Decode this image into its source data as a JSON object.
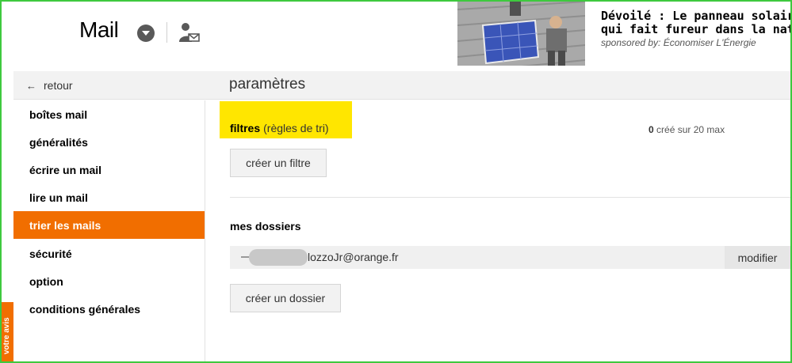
{
  "header": {
    "app_title": "Mail"
  },
  "ad": {
    "headline": "Dévoilé : Le panneau solaire\nqui fait fureur dans la nation",
    "sponsor": "sponsored by: Économiser L'Énergie"
  },
  "topbar": {
    "back_label": "retour",
    "page_title": "paramètres"
  },
  "sidebar": {
    "items": [
      {
        "label": "boîtes mail"
      },
      {
        "label": "généralités"
      },
      {
        "label": "écrire un mail"
      },
      {
        "label": "lire un mail"
      },
      {
        "label": "trier les mails",
        "active": true
      },
      {
        "label": "sécurité"
      },
      {
        "label": "option"
      },
      {
        "label": "conditions générales"
      }
    ],
    "feedback_label": "votre avis"
  },
  "filters": {
    "title": "filtres",
    "subtitle": "(règles de tri)",
    "count": "0",
    "count_suffix": "créé sur 20 max",
    "create_button": "créer un filtre"
  },
  "folders": {
    "title": "mes dossiers",
    "rows": [
      {
        "name": "lozzoJr@orange.fr",
        "action": "modifier"
      }
    ],
    "create_button": "créer un dossier"
  },
  "colors": {
    "accent": "#f16e00",
    "highlight": "#ffe600",
    "frame": "#3ec93e"
  }
}
